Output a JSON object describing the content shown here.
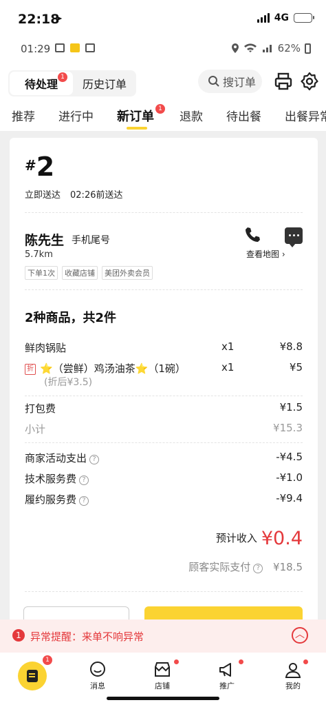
{
  "ios_status": {
    "time": "22:18",
    "network": "4G"
  },
  "android_status": {
    "time": "01:29",
    "battery": "62%"
  },
  "header": {
    "tab_pending": "待处理",
    "tab_pending_badge": "1",
    "tab_history": "历史订单",
    "search_placeholder": "搜订单"
  },
  "order_tabs": [
    {
      "label": "推荐"
    },
    {
      "label": "进行中"
    },
    {
      "label": "新订单",
      "badge": "1"
    },
    {
      "label": "退款"
    },
    {
      "label": "待出餐"
    },
    {
      "label": "出餐异常"
    }
  ],
  "order": {
    "hash": "#",
    "number": "2",
    "delivery_type": "立即送达",
    "delivery_time": "02:26前送达",
    "customer_name": "陈先生",
    "phone_label": "手机尾号",
    "distance": "5.7km",
    "map_link": "查看地图 ›",
    "tags": [
      "下单1次",
      "收藏店铺",
      "美团外卖会员"
    ],
    "items_title": "2种商品，共2件",
    "items": [
      {
        "name": "鲜肉锅贴",
        "qty": "x1",
        "price": "¥8.8"
      },
      {
        "discount_tag": "折",
        "star": "⭐",
        "name": "（尝鲜）鸡汤油茶",
        "star2": "⭐",
        "suffix": "（1碗）",
        "qty": "x1",
        "price": "¥5",
        "original": "(折后¥3.5)"
      }
    ],
    "packing_fee_label": "打包费",
    "packing_fee": "¥1.5",
    "subtotal_label": "小计",
    "subtotal": "¥15.3",
    "fees": [
      {
        "label": "商家活动支出",
        "value": "-¥4.5"
      },
      {
        "label": "技术服务费",
        "value": "-¥1.0"
      },
      {
        "label": "履约服务费",
        "value": "-¥9.4"
      }
    ],
    "income_label": "预计收入",
    "income_value": "¥0.4",
    "customer_paid_label": "顾客实际支付",
    "customer_paid": "¥18.5"
  },
  "alert": {
    "badge": "1",
    "text": "异常提醒：来单不响异常"
  },
  "bottom_nav": {
    "main_badge": "1",
    "items": [
      {
        "label": "消息"
      },
      {
        "label": "店铺"
      },
      {
        "label": "推广"
      },
      {
        "label": "我的"
      }
    ]
  },
  "colors": {
    "accent": "#fbd332",
    "danger": "#e4393c",
    "badge": "#f24b4b"
  }
}
